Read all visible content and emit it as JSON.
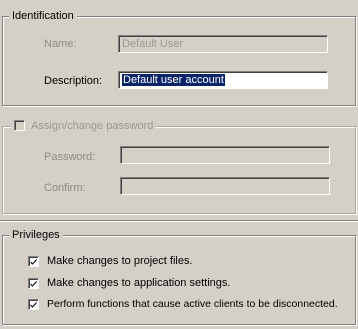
{
  "identification": {
    "title": "Identification",
    "name_label": "Name:",
    "name_value": "Default User",
    "description_label": "Description:",
    "description_value": "Default user account"
  },
  "password": {
    "title": "Assign/change password",
    "checked": false,
    "password_label": "Password:",
    "password_value": "",
    "confirm_label": "Confirm:",
    "confirm_value": ""
  },
  "privileges": {
    "title": "Privileges",
    "items": [
      {
        "label": "Make changes to project files.",
        "checked": true
      },
      {
        "label": "Make changes to application settings.",
        "checked": true
      },
      {
        "label": "Perform functions that cause active clients to be disconnected.",
        "checked": true
      }
    ]
  }
}
